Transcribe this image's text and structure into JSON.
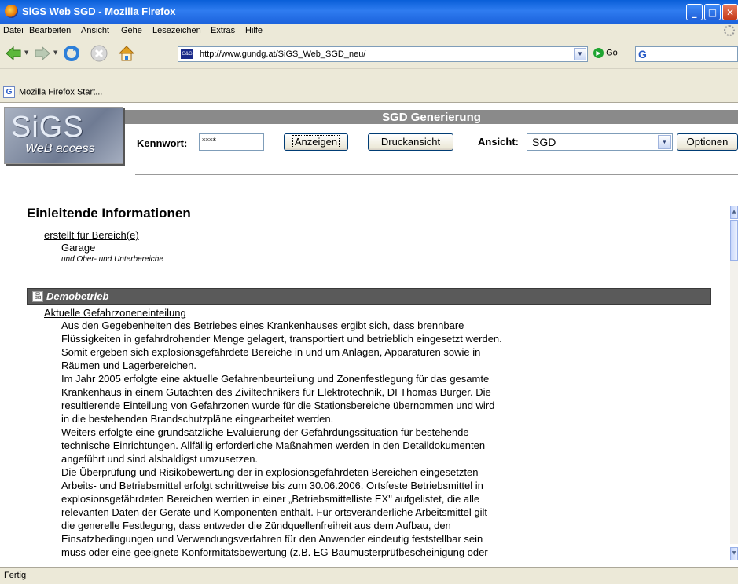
{
  "window": {
    "title": "SiGS Web SGD - Mozilla Firefox"
  },
  "menu": [
    "Datei",
    "Bearbeiten",
    "Ansicht",
    "Gehe",
    "Lesezeichen",
    "Extras",
    "Hilfe"
  ],
  "navbar": {
    "url": "http://www.gundg.at/SiGS_Web_SGD_neu/",
    "go_label": "Go"
  },
  "bookmarks": [
    "Mozilla Firefox Start..."
  ],
  "app": {
    "logo_line1": "SiGS",
    "logo_line2": "WeB access",
    "header_title": "SGD Generierung",
    "kennwort_label": "Kennwort:",
    "kennwort_value": "****",
    "anzeigen_label": "Anzeigen",
    "druck_label": "Druckansicht",
    "ansicht_label": "Ansicht:",
    "ansicht_value": "SGD",
    "optionen_label": "Optionen"
  },
  "content": {
    "intro_heading": "Einleitende Informationen",
    "bereich_label": "erstellt für Bereich(e)",
    "bereich_value": "Garage",
    "bereich_note": "und Ober- und Unterbereiche",
    "section_title": "Demobetrieb",
    "gefahr_label": "Aktuelle Gefahrzoneneinteilung",
    "paragraph_lines": [
      "Aus den Gegebenheiten des Betriebes eines Krankenhauses ergibt sich, dass brennbare",
      "Flüssigkeiten in gefahrdrohender Menge gelagert, transportiert und betrieblich eingesetzt werden.",
      "Somit ergeben sich explosionsgefährdete Bereiche in und um Anlagen, Apparaturen sowie in",
      "Räumen und Lagerbereichen.",
      "Im Jahr 2005 erfolgte eine aktuelle Gefahrenbeurteilung und Zonenfestlegung für das gesamte",
      "Krankenhaus in einem Gutachten des Ziviltechnikers für Elektrotechnik, DI Thomas Burger. Die",
      "resultierende Einteilung von Gefahrzonen wurde für die Stationsbereiche übernommen und wird",
      "in die bestehenden Brandschutzpläne eingearbeitet werden.",
      "Weiters erfolgte eine grundsätzliche Evaluierung der Gefährdungssituation für bestehende",
      "technische Einrichtungen. Allfällig erforderliche Maßnahmen werden in den Detaildokumenten",
      "angeführt und sind alsbaldigst umzusetzen.",
      "Die Überprüfung und Risikobewertung der in explosionsgefährdeten Bereichen eingesetzten",
      "Arbeits- und Betriebsmittel erfolgt schrittweise bis zum 30.06.2006. Ortsfeste Betriebsmittel in",
      "explosionsgefährdeten Bereichen werden in einer „Betriebsmittelliste EX\" aufgelistet, die alle",
      "relevanten Daten der Geräte und Komponenten enthält. Für ortsveränderliche Arbeitsmittel gilt",
      "die generelle Festlegung, dass entweder die Zündquellenfreiheit aus dem Aufbau, den",
      "Einsatzbedingungen und Verwendungsverfahren für den Anwender eindeutig feststellbar sein",
      "muss oder eine geeignete Konformitätsbewertung (z.B. EG-Baumusterprüfbescheinigung oder"
    ]
  },
  "status": {
    "text": "Fertig"
  },
  "icons": [
    "firefox-icon",
    "back-icon",
    "forward-icon",
    "reload-icon",
    "stop-icon",
    "home-icon",
    "site-icon",
    "go-icon",
    "google-icon",
    "section-icon"
  ],
  "colors": {
    "titlebar": "#0a5fd8",
    "header_bar": "#8a8a8a",
    "section_bar": "#5a5a5a"
  }
}
